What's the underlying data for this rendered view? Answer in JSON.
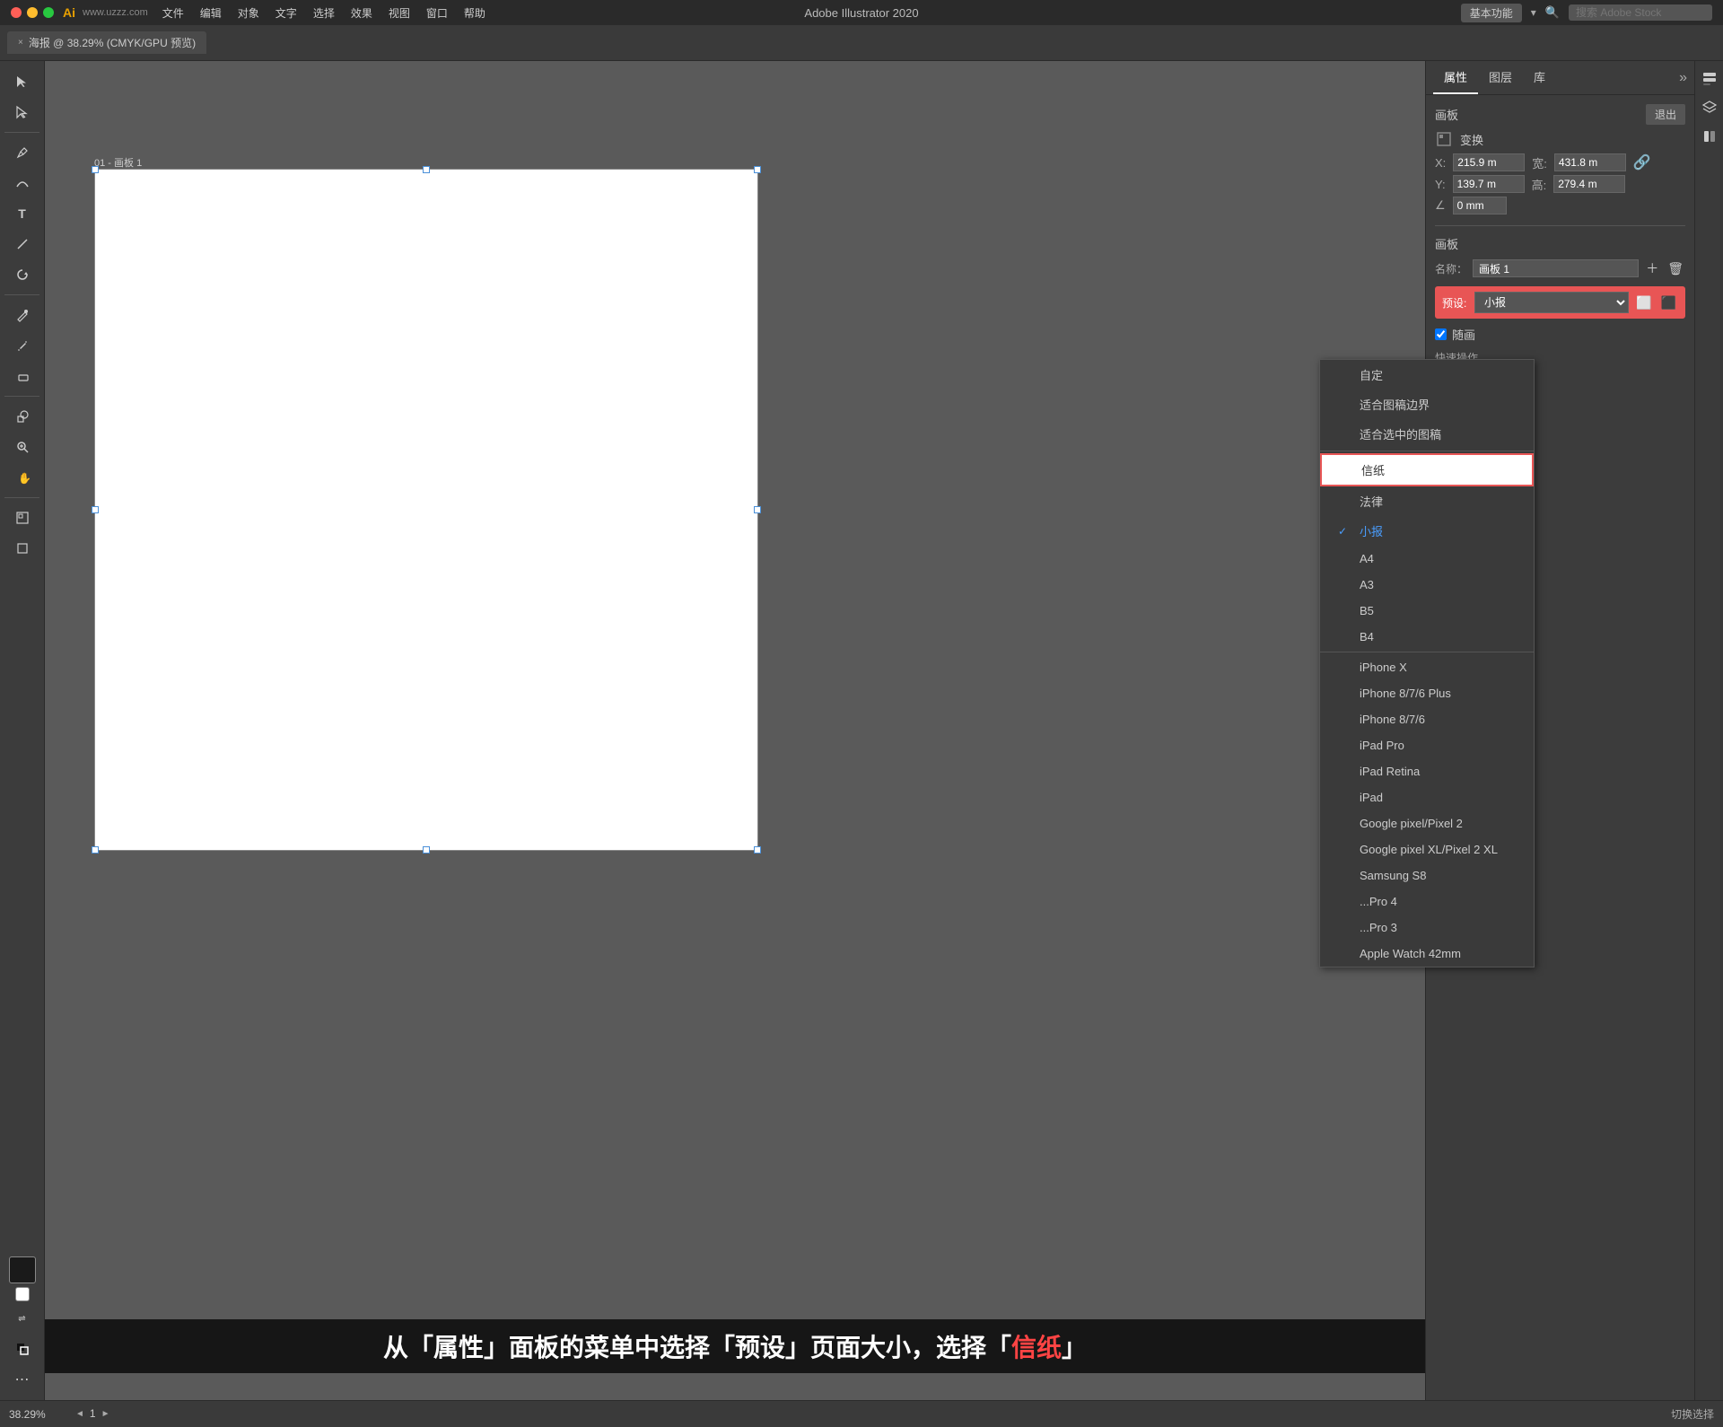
{
  "app": {
    "title": "Adobe Illustrator 2020",
    "logo": "Ai",
    "watermark": "www.uzzz.com"
  },
  "menubar": {
    "items": [
      "文件",
      "编辑",
      "对象",
      "文字",
      "选择",
      "效果",
      "视图",
      "窗口",
      "帮助"
    ]
  },
  "toolbar": {
    "workspace_label": "基本功能",
    "search_placeholder": "搜索 Adobe Stock"
  },
  "tab": {
    "close": "×",
    "title": "海报 @ 38.29% (CMYK/GPU 预览)"
  },
  "artboard": {
    "label": "01 - 画板 1"
  },
  "properties_panel": {
    "tabs": [
      "属性",
      "图层",
      "库"
    ],
    "more": "»",
    "section_artboard": "画板",
    "exit_btn": "退出",
    "transform_section": "变换",
    "x_label": "X:",
    "x_value": "215.9 m",
    "width_label": "宽:",
    "width_value": "431.8 m",
    "y_label": "Y:",
    "y_value": "139.7 m",
    "height_label": "高:",
    "height_value": "279.4 m",
    "angle_label": "∠",
    "angle_value": "0 mm",
    "artboard_section": "画板",
    "name_label": "名称：",
    "name_value": "画板 1",
    "preset_label": "预设:",
    "preset_value": "小报",
    "random_checkbox": "随画",
    "quick_ops": "快速操作"
  },
  "dropdown": {
    "items": [
      {
        "label": "自定",
        "selected": false,
        "highlighted": false
      },
      {
        "label": "适合图稿边界",
        "selected": false,
        "highlighted": false
      },
      {
        "label": "适合选中的图稿",
        "selected": false,
        "highlighted": false
      },
      {
        "label": "信纸",
        "selected": false,
        "highlighted": true
      },
      {
        "label": "法律",
        "selected": false,
        "highlighted": false
      },
      {
        "label": "小报",
        "selected": true,
        "highlighted": false
      },
      {
        "label": "A4",
        "selected": false,
        "highlighted": false
      },
      {
        "label": "A3",
        "selected": false,
        "highlighted": false
      },
      {
        "label": "B5",
        "selected": false,
        "highlighted": false
      },
      {
        "label": "B4",
        "selected": false,
        "highlighted": false
      },
      {
        "label": "iPhone X",
        "selected": false,
        "highlighted": false
      },
      {
        "label": "iPhone 8/7/6 Plus",
        "selected": false,
        "highlighted": false
      },
      {
        "label": "iPhone 8/7/6",
        "selected": false,
        "highlighted": false
      },
      {
        "label": "iPad Pro",
        "selected": false,
        "highlighted": false
      },
      {
        "label": "iPad Retina",
        "selected": false,
        "highlighted": false
      },
      {
        "label": "iPad",
        "selected": false,
        "highlighted": false
      },
      {
        "label": "Google pixel/Pixel 2",
        "selected": false,
        "highlighted": false
      },
      {
        "label": "Google pixel XL/Pixel 2 XL",
        "selected": false,
        "highlighted": false
      },
      {
        "label": "Samsung S8",
        "selected": false,
        "highlighted": false
      },
      {
        "label": "...Pro 4",
        "selected": false,
        "highlighted": false
      },
      {
        "label": "...Pro 3",
        "selected": false,
        "highlighted": false
      },
      {
        "label": "Apple Watch 42mm",
        "selected": false,
        "highlighted": false
      }
    ]
  },
  "status_bar": {
    "zoom": "38.29%",
    "page_num": "1",
    "nav_left": "◄",
    "nav_right": "►",
    "status_label": "切换选择"
  },
  "instruction": {
    "part1": "从「属性」面板的菜单中选择「预设」页面大小，选择「",
    "part2": "信纸",
    "part3": "」"
  }
}
